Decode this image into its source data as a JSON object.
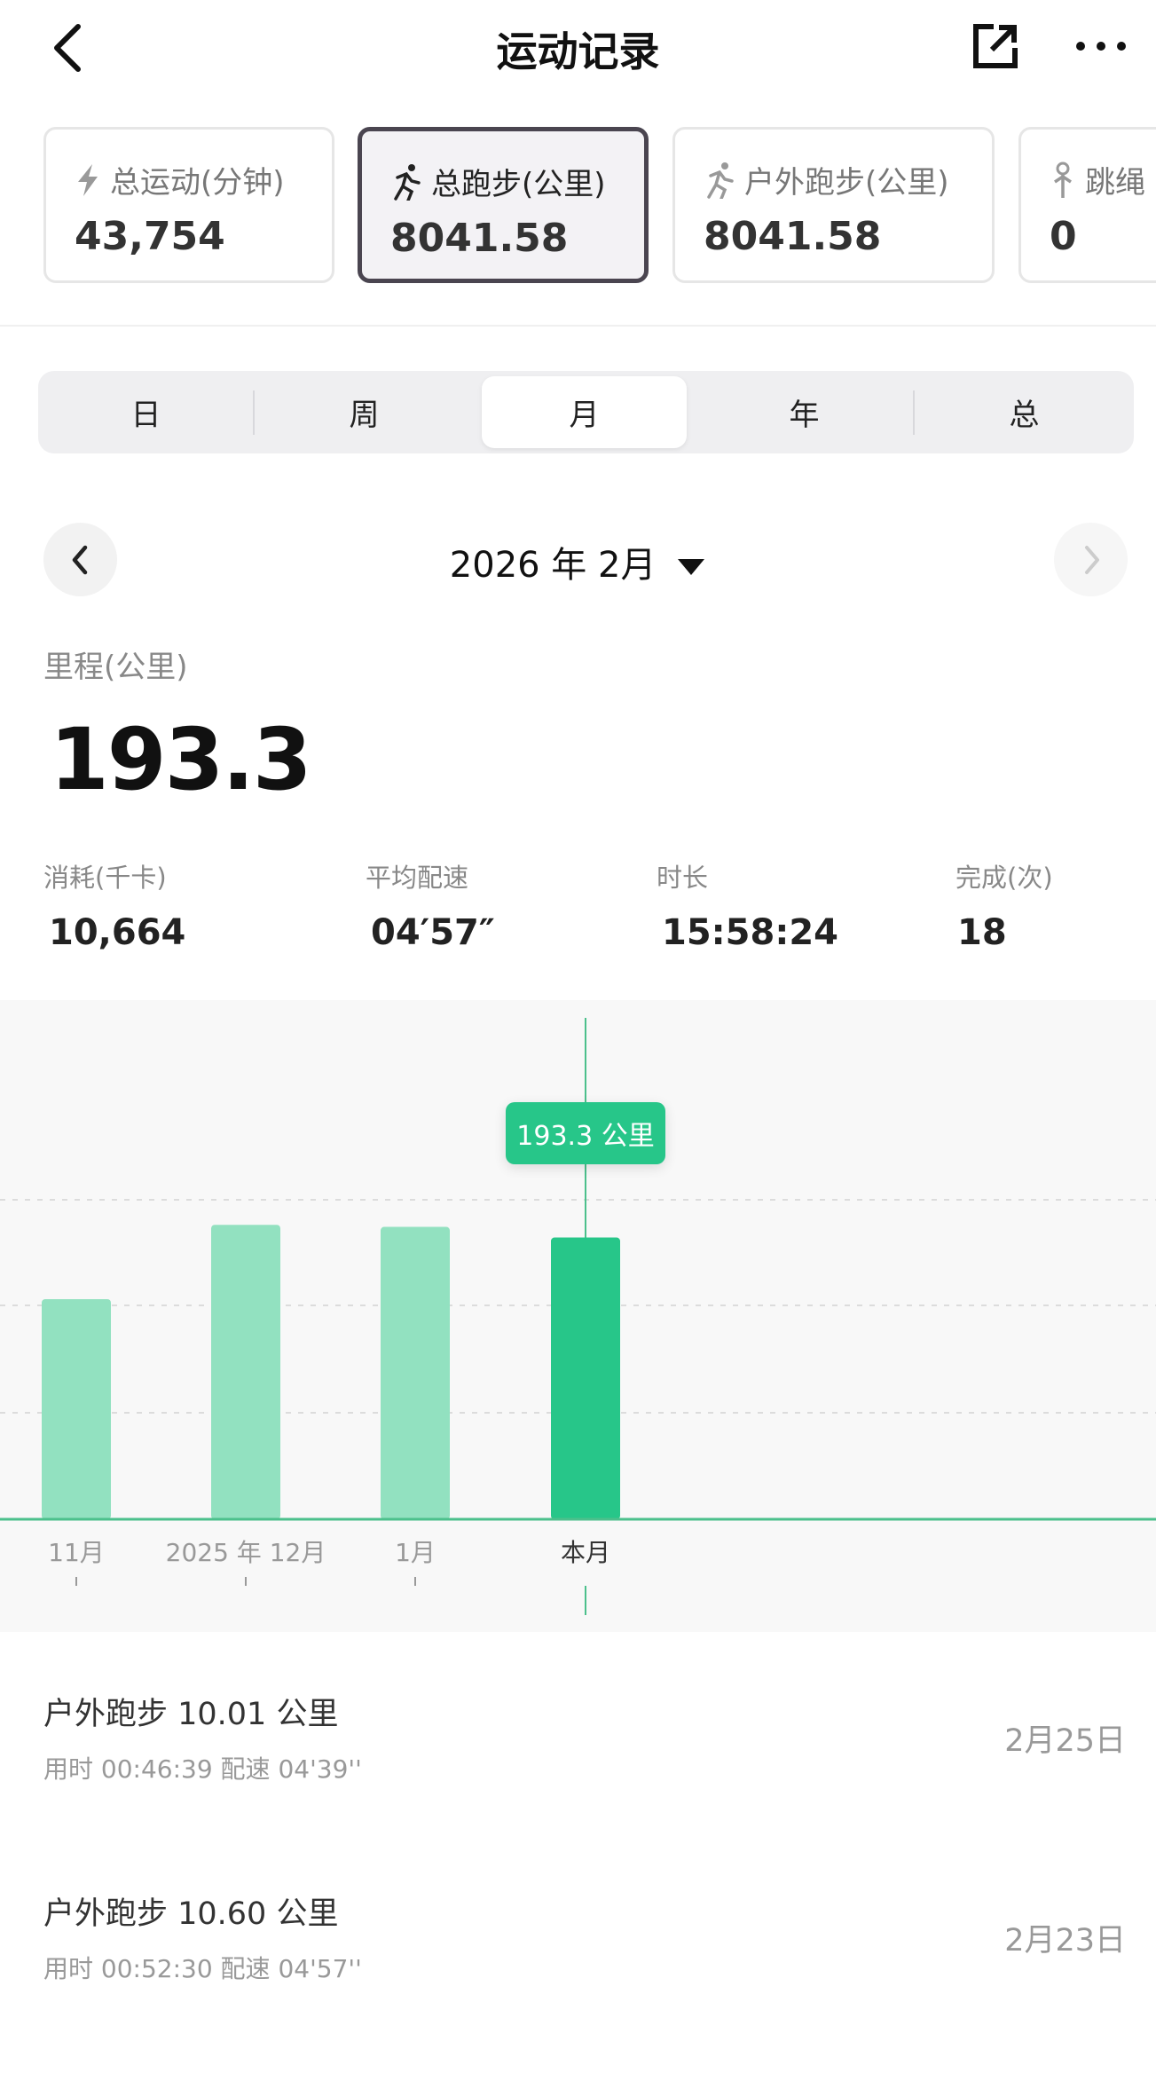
{
  "header": {
    "title": "运动记录",
    "back_icon": "chevron-left-icon",
    "share_icon": "share-icon",
    "more_icon": "more-icon"
  },
  "cards": [
    {
      "label": "总运动(分钟)",
      "value": "43,754",
      "icon": "lightning-icon"
    },
    {
      "label": "总跑步(公里)",
      "value": "8041.58",
      "icon": "runner-icon"
    },
    {
      "label": "户外跑步(公里)",
      "value": "8041.58",
      "icon": "runner-icon"
    },
    {
      "label": "跳绳",
      "value": "0",
      "icon": "jump-rope-icon"
    }
  ],
  "segments": [
    "日",
    "周",
    "月",
    "年",
    "总"
  ],
  "active_segment": "月",
  "period": {
    "title": "2026 年 2月"
  },
  "summary": {
    "label": "里程(公里)",
    "value": "193.3"
  },
  "stats": [
    {
      "label": "消耗(千卡)",
      "value": "10,664"
    },
    {
      "label": "平均配速",
      "value": "04′57″"
    },
    {
      "label": "时长",
      "value": "15:58:24"
    },
    {
      "label": "完成(次)",
      "value": "18"
    }
  ],
  "chart_data": {
    "type": "bar",
    "categories": [
      "11月",
      "2025 年 12月",
      "1月",
      "本月"
    ],
    "values": [
      151,
      202,
      200.6,
      193.3
    ],
    "highlight_index": 3,
    "tooltip": "193.3 公里",
    "unit": "公里",
    "ylim": [
      0,
      344
    ],
    "colors": {
      "bar": "#92e1c0",
      "active": "#27c689",
      "axis": "#4cc08c"
    }
  },
  "records": [
    {
      "title": "户外跑步  10.01 公里",
      "sub": "用时 00:46:39    配速 04'39''",
      "date": "2月25日"
    },
    {
      "title": "户外跑步  10.60 公里",
      "sub": "用时 00:52:30    配速 04'57''",
      "date": "2月23日"
    }
  ]
}
